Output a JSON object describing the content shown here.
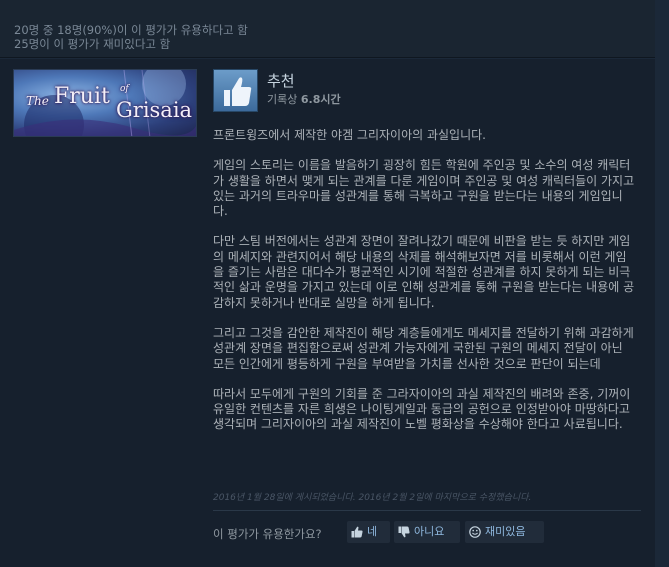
{
  "summary": {
    "helpful_line": "20명 중 18명(90%)이 이 평가가 유용하다고 함",
    "funny_line": "25명이 이 평가가 재미있다고 함"
  },
  "game": {
    "logo_the": "The",
    "logo_fruit": "Fruit",
    "logo_of": "of",
    "logo_grisaia": "Grisaia"
  },
  "recommendation": {
    "icon": "thumbs-up-icon",
    "title": "추천",
    "hours_prefix": "기록상 ",
    "hours_value": "6.8시간"
  },
  "review": {
    "paragraphs": [
      "프론트윙즈에서 제작한 야겜 그리자이아의 과실입니다.",
      "게임의 스토리는 이름을 발음하기 굉장히 힘든 학원에 주인공 및 소수의 여성 캐릭터가 생활을 하면서 맺게 되는 관계를 다룬 게임이며 주인공 및 여성 캐릭터들이 가지고 있는 과거의 트라우마를 성관계를 통해 극복하고 구원을 받는다는 내용의 게임입니다.",
      "다만 스팀 버전에서는 성관계 장면이 잘려나갔기 때문에 비판을 받는 듯 하지만 게임의 메세지와 관련지어서 해당 내용의 삭제를 해석해보자면 저를 비롯해서 이런 게임을 즐기는 사람은 대다수가 평균적인 시기에 적절한 성관계를 하지 못하게 되는 비극적인 삶과 운명을 가지고 있는데 이로 인해 성관계를 통해 구원을 받는다는 내용에 공감하지 못하거나 반대로 실망을 하게 됩니다.",
      "그리고 그것을 감안한 제작진이 해당 계층들에게도 메세지를 전달하기 위해 과감하게 성관계 장면을 편집함으로써 성관계 가능자에게 국한된 구원의 메세지 전달이 아닌 모든 인간에게 평등하게 구원을 부여받을 가치를 선사한 것으로 판단이 되는데",
      "따라서 모두에게 구원의 기회를 준 그라자이아의 과실 제작진의 배려와 존중, 기꺼이 유일한 컨텐츠를 자른 희생은 나이팅게일과 동급의 공헌으로 인정받아야 마땅하다고 생각되며 그리자이아의 과실 제작진이 노벨 평화상을 수상해야 한다고 사료됩니다."
    ],
    "posted": "2016년 1월 28일에 게시되었습니다. 2016년 2월 2일에 마지막으로 수정했습니다."
  },
  "voting": {
    "question": "이 평가가 유용한가요?",
    "yes_label": "네",
    "no_label": "아니요",
    "funny_label": "재미있음"
  },
  "colors": {
    "background": "#1b2838",
    "panel": "#16202d",
    "text": "#acb2b8",
    "accent": "#8fb8de"
  }
}
